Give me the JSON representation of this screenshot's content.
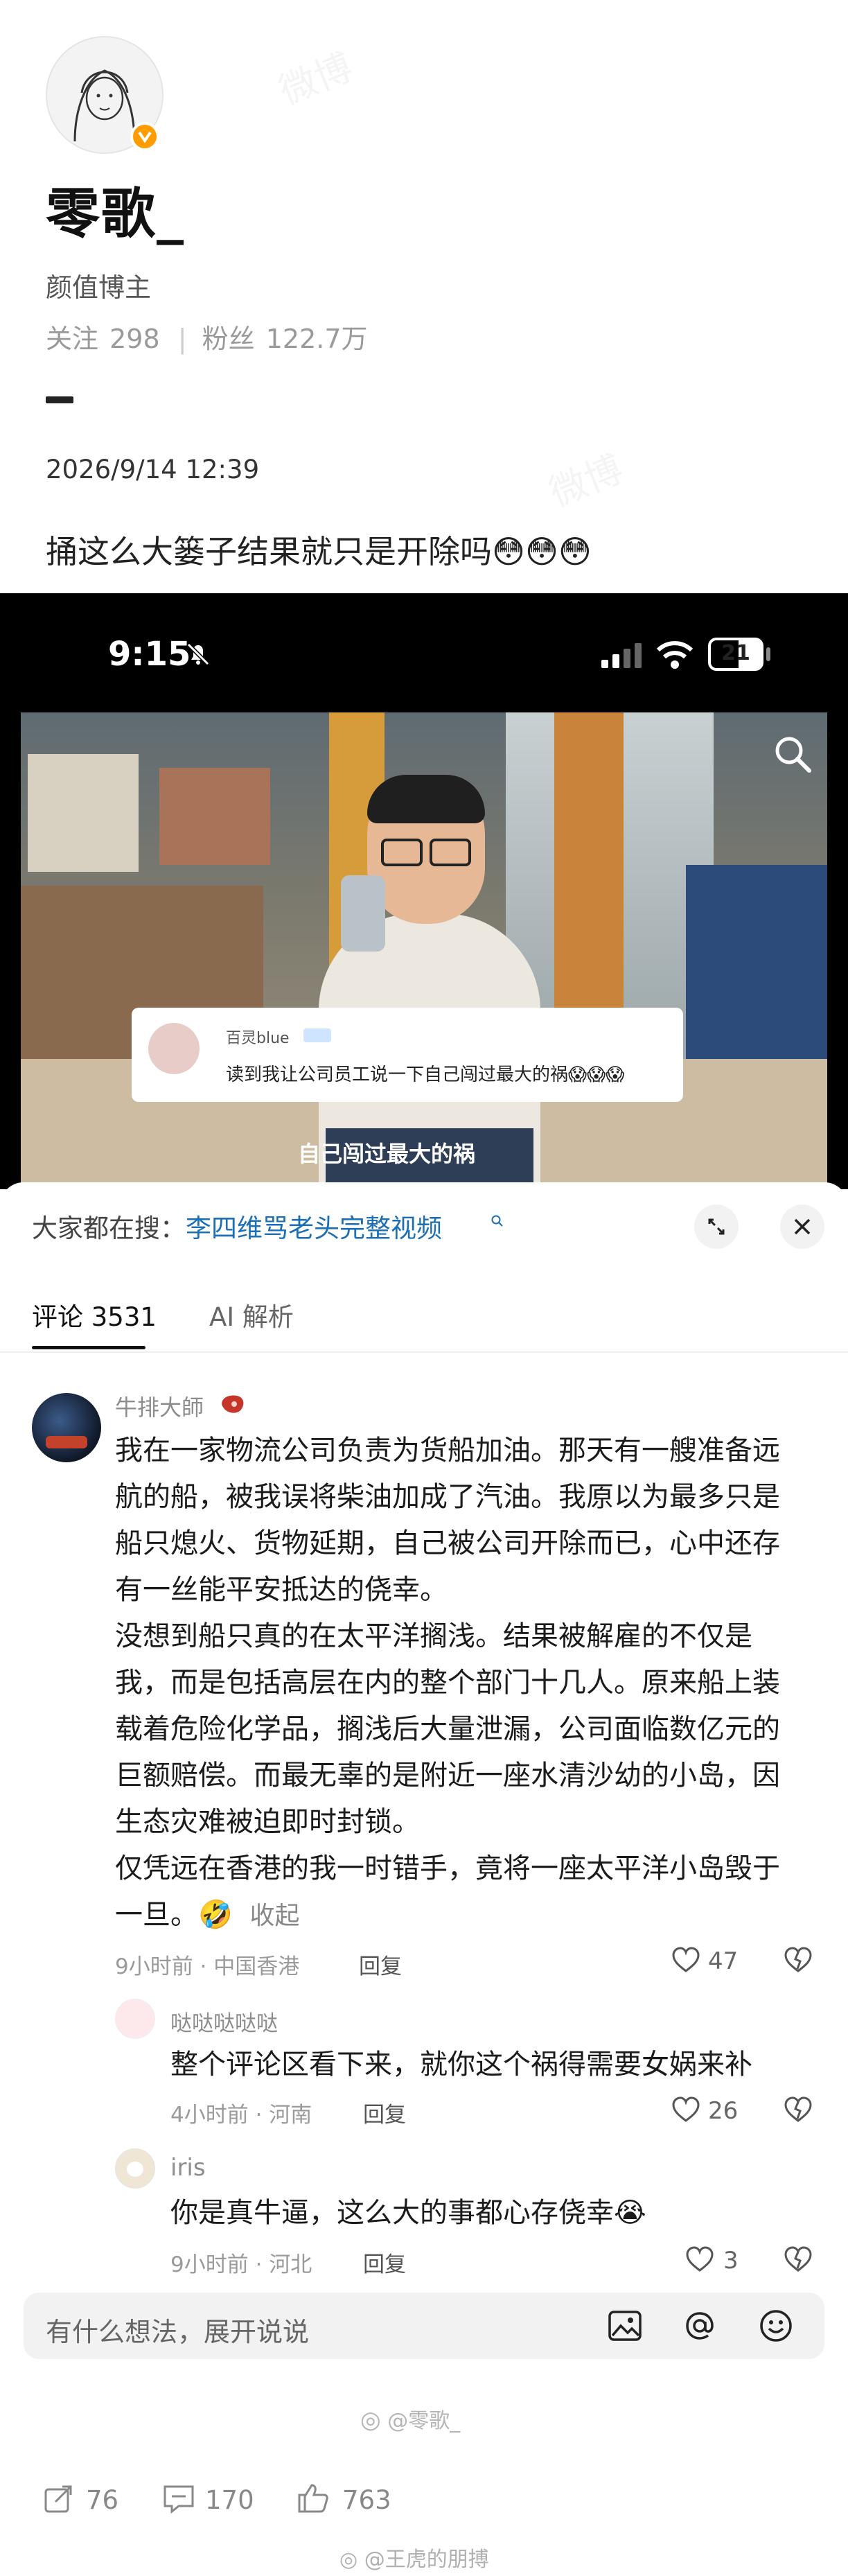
{
  "profile": {
    "username": "零歌_",
    "tag": "颜值博主",
    "follow_label": "关注",
    "follow_count": "298",
    "fans_label": "粉丝",
    "fans_count": "122.7万",
    "verified_icon": "v-badge-icon"
  },
  "post": {
    "time": "2026/9/14 12:39",
    "text": "捅这么大篓子结果就只是开除吗😳😳😳"
  },
  "screenshot": {
    "status_time": "9:15",
    "battery": "21",
    "video": {
      "overlay_user": "百灵blue",
      "overlay_text": "读到我让公司员工说一下自己闯过最大的祸😱😱😱",
      "caption": "自己闯过最大的祸"
    }
  },
  "sheet": {
    "search_prefix": "大家都在搜：",
    "search_term": "李四维骂老头完整视频",
    "tabs": [
      {
        "label": "评论 3531"
      },
      {
        "label": "AI 解析"
      }
    ],
    "comments": [
      {
        "user": "牛排大師",
        "lines": [
          "我在一家物流公司负责为货船加油。那天有一艘准备远",
          "航的船，被我误将柴油加成了汽油。我原以为最多只是",
          "船只熄火、货物延期，自己被公司开除而已，心中还存",
          "有一丝能平安抵达的侥幸。",
          "没想到船只真的在太平洋搁浅。结果被解雇的不仅是",
          "我，而是包括高层在内的整个部门十几人。原来船上装",
          "载着危险化学品，搁浅后大量泄漏，公司面临数亿元的",
          "巨额赔偿。而最无辜的是附近一座水清沙幼的小岛，因",
          "生态灾难被迫即时封锁。",
          "仅凭远在香港的我一时错手，竟将一座太平洋小岛毁于",
          "一旦。🤣"
        ],
        "collapse": "收起",
        "time_loc": "9小时前 · 中国香港",
        "reply": "回复",
        "likes": "47"
      },
      {
        "user": "哒哒哒哒哒",
        "text": "整个评论区看下来，就你这个祸得需要女娲来补",
        "time_loc": "4小时前 · 河南",
        "reply": "回复",
        "likes": "26"
      },
      {
        "user": "iris",
        "text": "你是真牛逼，这么大的事都心存侥幸😭",
        "time_loc": "9小时前 · 河北",
        "reply": "回复",
        "likes": "3"
      }
    ],
    "composer_placeholder": "有什么想法，展开说说"
  },
  "footer": {
    "share_count": "76",
    "comment_count": "170",
    "like_count": "763",
    "watermark_top": "@零歌_",
    "watermark_bottom": "@王虎的朋搏"
  },
  "colors": {
    "link_blue": "#1c6fb5",
    "verified_orange": "#ff9d00",
    "video_black": "#000000"
  }
}
